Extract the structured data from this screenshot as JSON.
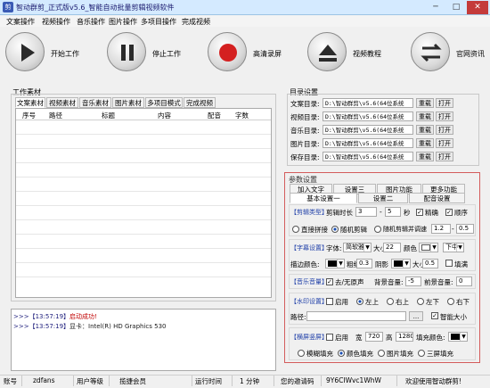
{
  "app": {
    "title": "智动群剪_正式版v5.6_智能自动批量剪辑视频软件",
    "window_buttons": [
      "─",
      "□",
      "✕"
    ]
  },
  "menu": [
    "文案操作",
    "视频操作",
    "音乐操作",
    "图片操作",
    "多项目操作",
    "完成视频"
  ],
  "toolbar": {
    "start": "开始工作",
    "stop": "停止工作",
    "record": "高清录屏",
    "tutorial": "视频教程",
    "official": "官网资讯"
  },
  "work_material": {
    "group_title": "工作素材",
    "tabs": [
      "文案素材",
      "视频素材",
      "音乐素材",
      "图片素材",
      "多项目模式",
      "完成视频"
    ],
    "columns": [
      "序号",
      "路径",
      "标题",
      "内容",
      "配音",
      "字数"
    ]
  },
  "log": [
    {
      "stamp": ">>>【13:57:19】",
      "text": "启动成功!",
      "color": "#c00000"
    },
    {
      "stamp": ">>>【13:57:19】",
      "text": "显卡：Intel(R) HD Graphics 530",
      "color": "#1a1a7a"
    }
  ],
  "status": [
    {
      "label": "账号",
      "value": "zdfans"
    },
    {
      "label": "用户等级",
      "value": "揽捷会员"
    },
    {
      "label": "运行时间",
      "value": "1 分钟"
    },
    {
      "label": "您的邀请码",
      "value": "9Y6CIWvc1WhW"
    },
    {
      "label": "",
      "value": "欢迎使用智动群剪!"
    }
  ],
  "dirs": {
    "group_title": "目录设置",
    "rows": [
      {
        "label": "文案目录:",
        "path": "D:\\智动群剪\\v5.6(64位系统"
      },
      {
        "label": "视频目录:",
        "path": "D:\\智动群剪\\v5.6(64位系统"
      },
      {
        "label": "音乐目录:",
        "path": "D:\\智动群剪\\v5.6(64位系统"
      },
      {
        "label": "图片目录:",
        "path": "D:\\智动群剪\\v5.6(64位系统"
      },
      {
        "label": "保存目录:",
        "path": "D:\\智动群剪\\v5.6(64位系统"
      }
    ],
    "btn_reload": "重载",
    "btn_open": "打开"
  },
  "params": {
    "group_title": "参数设置",
    "tabs_row1": [
      "加入文字",
      "设置三",
      "图片功能",
      "更多功能"
    ],
    "tabs_row2": [
      "基本设置一",
      "设置二",
      "配音设置"
    ],
    "cut": {
      "title": "【剪辑类型】",
      "duration_label": "剪辑时长",
      "from": "3",
      "dash": "-",
      "to": "5",
      "unit": "秒",
      "precise": "精确",
      "order": "顺序",
      "direct": "直接拼接",
      "random": "随机剪辑",
      "random_speed": "随机剪辑并调速",
      "speed_from": "1.2",
      "speed_to": "0.5"
    },
    "subtitle": {
      "title": "【字幕设置】",
      "font_label": "字体:",
      "font": "简软雅",
      "size_label": "大小",
      "size": "22",
      "color_label": "颜色",
      "color": "#ffffff",
      "position": "下中",
      "stroke_label": "描边颜色:",
      "stroke_color": "#000000",
      "thick_label": "粗细",
      "thick": "0.3",
      "shadow_label": "阴影",
      "shadow_color": "#000000",
      "shadow_size_label": "大小",
      "shadow_size": "0.5",
      "fill_label": "填满"
    },
    "music": {
      "title": "【音乐音量】",
      "mute": "去/无原声",
      "bg_label": "背景音量:",
      "bg": "-5",
      "front_label": "前景音量:",
      "front": "0"
    },
    "watermark": {
      "title": "【水印设置】",
      "enable": "启用",
      "pos": [
        "左上",
        "右上",
        "左下",
        "右下"
      ],
      "path_label": "路径:",
      "path": "",
      "browse": "...",
      "smart": "智能大小"
    },
    "landscape": {
      "title": "【横屏竖屏】",
      "enable": "启用",
      "width_label": "宽",
      "width": "720",
      "height_label": "高",
      "height": "1280",
      "fill_color_label": "填充颜色:",
      "fill_color": "#000000",
      "modes": [
        "模糊填充",
        "颜色填充",
        "图片填充",
        "三屏填充"
      ]
    }
  },
  "colors": {
    "accent": "#1f3fa8",
    "red": "#d45c5c"
  }
}
